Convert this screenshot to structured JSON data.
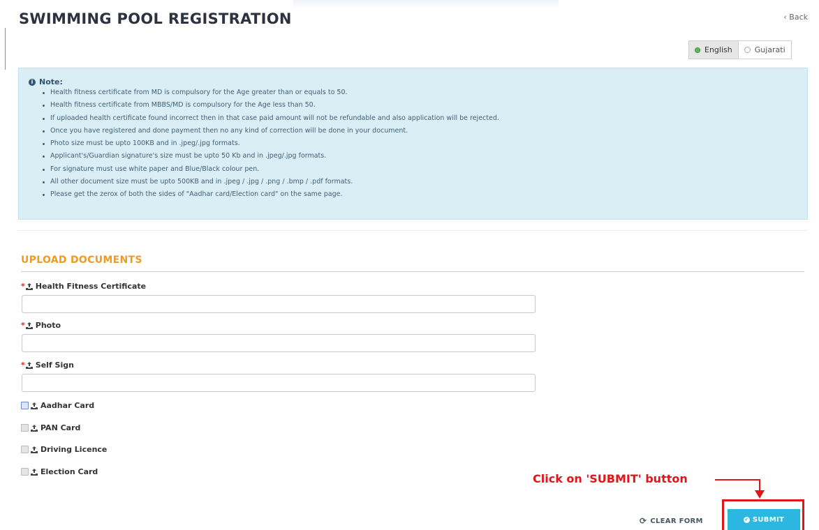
{
  "page": {
    "title": "SWIMMING POOL REGISTRATION",
    "back_label": "‹ Back"
  },
  "language": {
    "options": [
      "English",
      "Gujarati"
    ],
    "selected": "English"
  },
  "note": {
    "heading": "Note:",
    "items": [
      "Health fitness certificate from MD is compulsory for the Age greater than or equals to 50.",
      "Health fitness certificate from MBBS/MD is compulsory for the Age less than 50.",
      "If uploaded health certificate found incorrect then in that case paid amount will not be refundable and also application will be rejected.",
      "Once you have registered and done payment then no any kind of correction will be done in your document.",
      "Photo size must be upto 100KB and in .jpeg/.jpg formats.",
      "Applicant's/Guardian signature's size must be upto 50 Kb and in .jpeg/.jpg formats.",
      "For signature must use white paper and Blue/Black colour pen.",
      "All other document size must be upto 500KB and in .jpeg / .jpg / .png / .bmp / .pdf formats.",
      "Please get the zerox of both the sides of \"Aadhar card/Election card\" on the same page."
    ]
  },
  "upload": {
    "section_title": "UPLOAD DOCUMENTS",
    "required_marker": "*",
    "required_fields": [
      {
        "label": "Health Fitness Certificate",
        "value": ""
      },
      {
        "label": "Photo",
        "value": ""
      },
      {
        "label": "Self Sign",
        "value": ""
      }
    ],
    "optional_documents": [
      {
        "label": "Aadhar Card",
        "checked": false
      },
      {
        "label": "PAN Card",
        "checked": false
      },
      {
        "label": "Driving Licence",
        "checked": false
      },
      {
        "label": "Election Card",
        "checked": false
      }
    ]
  },
  "actions": {
    "clear_label": "CLEAR FORM",
    "submit_label": "SUBMIT"
  },
  "annotation": {
    "text": "Click on 'SUBMIT' button",
    "color": "#e3151b"
  },
  "colors": {
    "section_accent": "#f39a1e",
    "note_background": "#daeef6",
    "submit_background": "#2bb7df"
  },
  "icons": {
    "field_label_icon": "upload-icon",
    "clear_icon": "refresh-icon",
    "submit_icon": "check-circle-icon",
    "note_icon": "info-icon"
  }
}
